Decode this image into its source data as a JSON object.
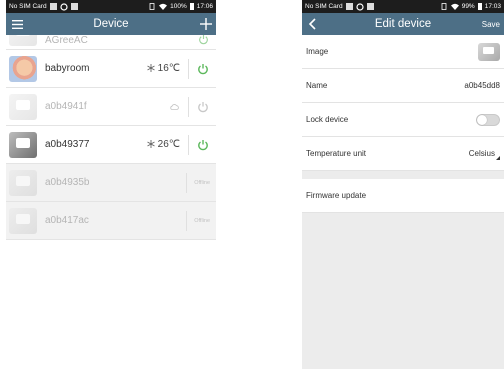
{
  "left": {
    "status": {
      "carrier": "No SIM Card",
      "battery": "100%",
      "time": "17:06"
    },
    "header": {
      "title": "Device",
      "menu_icon": "hamburger-icon",
      "add_icon": "plus-icon"
    },
    "devices": [
      {
        "name": "AGreeAC",
        "temp": "",
        "state": "on-partial"
      },
      {
        "name": "babyroom",
        "temp": "16℃",
        "state": "on"
      },
      {
        "name": "a0b4941f",
        "temp": "",
        "state": "dim"
      },
      {
        "name": "a0b49377",
        "temp": "26℃",
        "state": "on"
      },
      {
        "name": "a0b4935b",
        "temp": "",
        "state": "offline"
      },
      {
        "name": "a0b417ac",
        "temp": "",
        "state": "offline"
      }
    ],
    "offline_label": "Offline"
  },
  "right": {
    "status": {
      "carrier": "No SIM Card",
      "battery": "99%",
      "time": "17:03"
    },
    "header": {
      "title": "Edit device",
      "save": "Save",
      "back_icon": "back-chevron-icon"
    },
    "rows": {
      "image": "Image",
      "name_label": "Name",
      "name_value": "a0b45dd8",
      "lock": "Lock device",
      "lock_on": false,
      "temp_label": "Temperature unit",
      "temp_value": "Celsius",
      "firmware": "Firmware update"
    }
  },
  "colors": {
    "header": "#4d6f86",
    "power_on": "#5cb85c",
    "power_off": "#c8c8c8"
  }
}
